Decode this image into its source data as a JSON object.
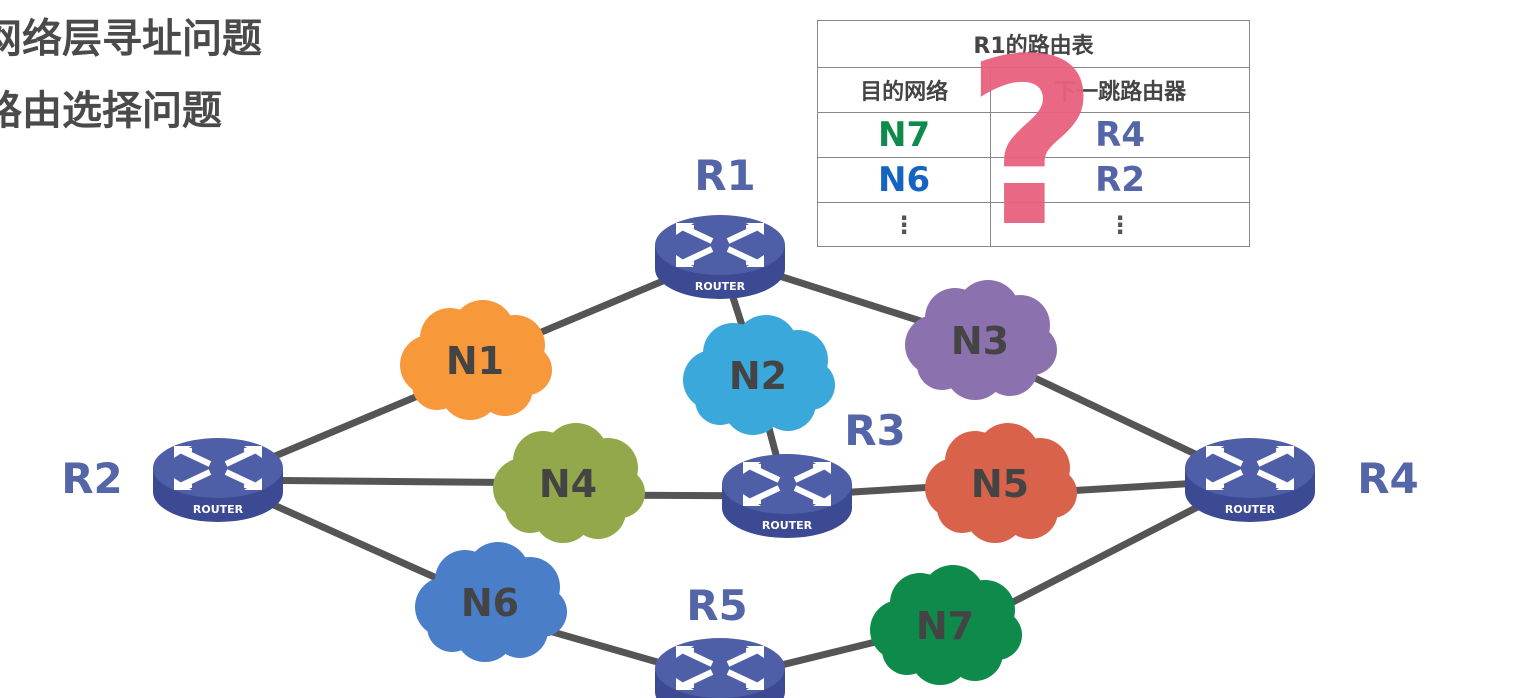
{
  "headings": [
    "网络层寻址问题",
    "路由选择问题"
  ],
  "routing_table": {
    "title": "R1的路由表",
    "columns": [
      "目的网络",
      "下一跳路由器"
    ],
    "rows": [
      {
        "dest": "N7",
        "next": "R4",
        "dest_color": "#0E8A4A"
      },
      {
        "dest": "N6",
        "next": "R2",
        "dest_color": "#1565C0"
      }
    ],
    "ellipsis": "⋮",
    "overlay_symbol": "?"
  },
  "routers": [
    {
      "id": "R1",
      "label": "R1",
      "badge": "ROUTER"
    },
    {
      "id": "R2",
      "label": "R2",
      "badge": "ROUTER"
    },
    {
      "id": "R3",
      "label": "R3",
      "badge": "ROUTER"
    },
    {
      "id": "R4",
      "label": "R4",
      "badge": "ROUTER"
    },
    {
      "id": "R5",
      "label": "R5",
      "badge": "ROUTER"
    }
  ],
  "networks": [
    {
      "id": "N1",
      "label": "N1",
      "color": "#F7993A"
    },
    {
      "id": "N2",
      "label": "N2",
      "color": "#3AA8DB"
    },
    {
      "id": "N3",
      "label": "N3",
      "color": "#8B72AE"
    },
    {
      "id": "N4",
      "label": "N4",
      "color": "#93A84B"
    },
    {
      "id": "N5",
      "label": "N5",
      "color": "#D8634A"
    },
    {
      "id": "N6",
      "label": "N6",
      "color": "#4A7EC8"
    },
    {
      "id": "N7",
      "label": "N7",
      "color": "#0E8A4A"
    }
  ],
  "links": [
    [
      "R1",
      "N1",
      "R2"
    ],
    [
      "R1",
      "N2",
      "R3"
    ],
    [
      "R1",
      "N3",
      "R4"
    ],
    [
      "R2",
      "N4",
      "R3"
    ],
    [
      "R3",
      "N5",
      "R4"
    ],
    [
      "R2",
      "N6",
      "R5"
    ],
    [
      "R5",
      "N7",
      "R4"
    ]
  ],
  "colors": {
    "router": "#4E5FA8",
    "router_label": "#5466A8",
    "link": "#555555",
    "text": "#444444"
  }
}
